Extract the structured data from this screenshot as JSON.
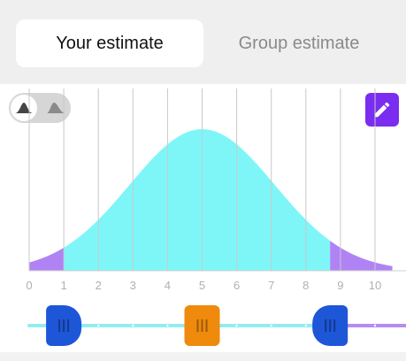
{
  "tabs": [
    {
      "label": "Your estimate",
      "active": true
    },
    {
      "label": "Group estimate",
      "active": false
    }
  ],
  "controls": {
    "shape_toggle_icons": [
      "normal-distribution-icon",
      "skewed-distribution-icon"
    ],
    "edit_icon": "pencil-icon"
  },
  "colors": {
    "curve_fill": "#7ef6f8",
    "tail_fill": "#b083f5",
    "handle_blue": "#1e56d8",
    "handle_orange": "#ef8a0c",
    "track": "#92ecf2",
    "edit_button": "#7a2cf0"
  },
  "chart_data": {
    "type": "area",
    "title": "",
    "xlabel": "",
    "ylabel": "",
    "x_ticks": [
      "0",
      "1",
      "2",
      "3",
      "4",
      "5",
      "6",
      "7",
      "8",
      "9",
      "10"
    ],
    "xlim": [
      0,
      10.5
    ],
    "distribution": {
      "shape": "normal",
      "mean": 5.0,
      "sd": 2.1
    },
    "highlight_interval": [
      1.0,
      8.7
    ],
    "grid": true
  },
  "slider": {
    "low": 1.0,
    "median": 5.0,
    "high": 8.7
  }
}
